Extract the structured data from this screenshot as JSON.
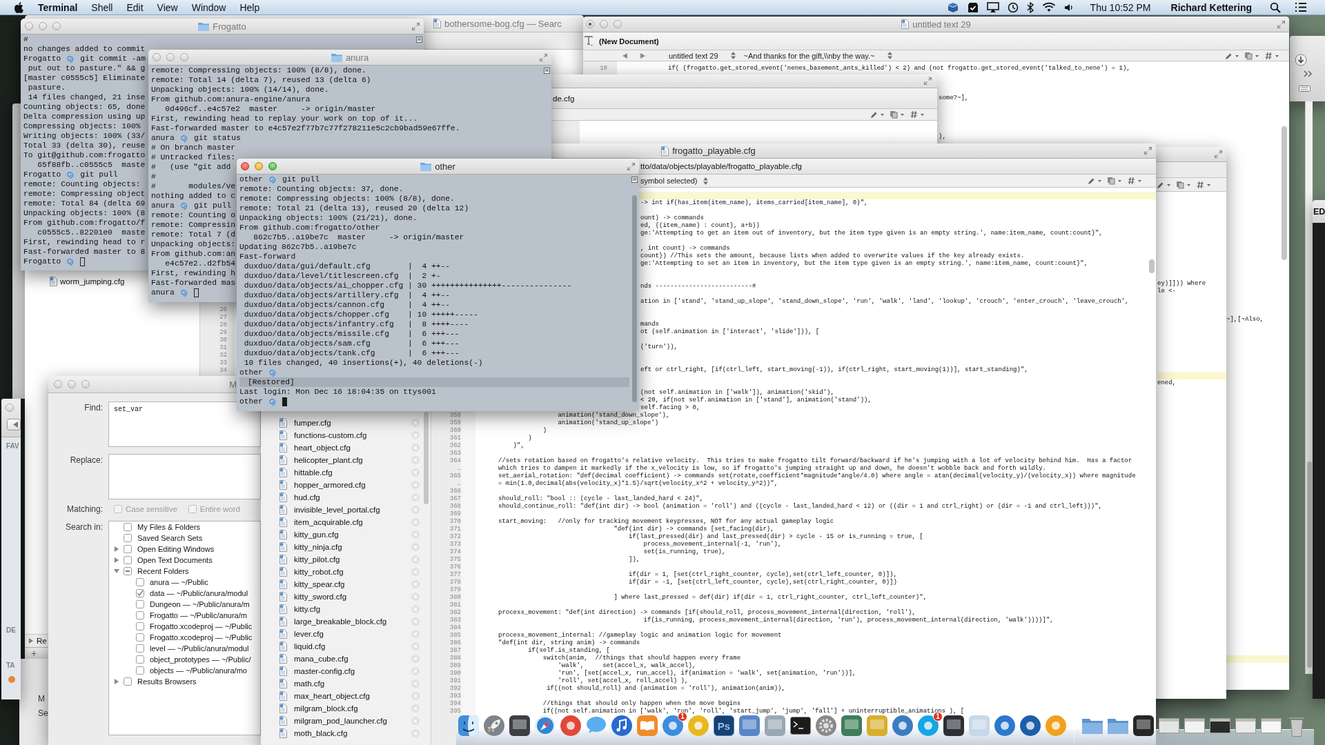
{
  "menu_bar": {
    "app": "Terminal",
    "menus": [
      "Shell",
      "Edit",
      "View",
      "Window",
      "Help"
    ],
    "clock": "Thu 10:52 PM",
    "user": "Richard Kettering"
  },
  "finder_window": {
    "headings": [
      "FAV",
      "DE",
      "TA"
    ],
    "tags": [
      {
        "color": "#e8883a"
      }
    ]
  },
  "bothersome_window": {
    "title": "bothersome-bog.cfg — Searc",
    "files": [
      "worm_jumping.cfg"
    ],
    "line_numbers": [
      "26",
      "27",
      "28",
      "29",
      "30",
      "31",
      "32",
      "33",
      "34"
    ],
    "sidebar_section": "Re",
    "add_button": "+"
  },
  "lower_window": {
    "labels": [
      "M",
      "Se"
    ]
  },
  "right_window": {
    "title": "ED"
  },
  "untitled_window": {
    "title": "untitled text 29",
    "focused": false,
    "unsaved": true,
    "toolbar_label": "(New Document)",
    "document_popup": "untitled text 29",
    "symbol_popup": "~And thanks for the gift,\\\\nby the way.~",
    "code": [
      {
        "n": "10",
        "text": "if( (frogatto.get_stored_event('nenes_basement_ants_killed') < 2) and (not frogatto.get_stored_event('talked_to_nene') = 1),"
      }
    ],
    "center_fragments": [
      "some?~],",
      "),"
    ],
    "right_fragments": [
      "~],[~Also,"
    ],
    "current_line_highlight": true
  },
  "middle_window": {
    "fragments": [
      "ey)]])) where",
      "le <-",
      "ened,"
    ],
    "current_line_highlight": true
  },
  "de_window": {
    "path": "de.cfg"
  },
  "find_dialog": {
    "title": "M",
    "focused": false,
    "find_label": "Find:",
    "find_value": "set_var",
    "replace_label": "Replace:",
    "matching_label": "Matching:",
    "matching": [
      {
        "label": "Case sensitive",
        "checked": false,
        "disabled": true
      },
      {
        "label": "Entire word",
        "checked": false,
        "disabled": true
      }
    ],
    "search_in_label": "Search in:",
    "search_in": [
      {
        "kind": "leaf",
        "label": "My Files & Folders",
        "checked": false,
        "mixed": false
      },
      {
        "kind": "leaf",
        "label": "Saved Search Sets",
        "checked": false,
        "mixed": false
      },
      {
        "kind": "group",
        "label": "Open Editing Windows",
        "checked": false,
        "mixed": false,
        "expanded": false
      },
      {
        "kind": "group",
        "label": "Open Text Documents",
        "checked": false,
        "mixed": false,
        "expanded": false
      },
      {
        "kind": "group",
        "label": "Recent Folders",
        "checked": false,
        "mixed": true,
        "expanded": true,
        "children": [
          {
            "label": "anura — ~/Public",
            "checked": false
          },
          {
            "label": "data — ~/Public/anura/modul",
            "checked": true
          },
          {
            "label": "Dungeon — ~/Public/anura/m",
            "checked": false
          },
          {
            "label": "Frogatto — ~/Public/anura/m",
            "checked": false
          },
          {
            "label": "Frogatto.xcodeproj — ~/Public",
            "checked": false
          },
          {
            "label": "Frogatto.xcodeproj — ~/Public",
            "checked": false
          },
          {
            "label": "level — ~/Public/anura/modul",
            "checked": false
          },
          {
            "label": "object_prototypes — ~/Public/",
            "checked": false
          },
          {
            "label": "objects — ~/Public/anura/mo",
            "checked": false
          }
        ]
      },
      {
        "kind": "group",
        "label": "Results Browsers",
        "checked": false,
        "mixed": false,
        "expanded": false
      }
    ]
  },
  "playable_window": {
    "title": "frogatto_playable.cfg",
    "path": "tto/data/objects/playable/frogatto_playable.cfg",
    "symbol_popup": "symbol selected)",
    "current_line_highlight": true,
    "files": [
      "fumper.cfg",
      "functions-custom.cfg",
      "heart_object.cfg",
      "helicopter_plant.cfg",
      "hittable.cfg",
      "hopper_armored.cfg",
      "hud.cfg",
      "invisible_level_portal.cfg",
      "item_acquirable.cfg",
      "kitty_gun.cfg",
      "kitty_ninja.cfg",
      "kitty_pilot.cfg",
      "kitty_robot.cfg",
      "kitty_spear.cfg",
      "kitty_sword.cfg",
      "kitty.cfg",
      "large_breakable_block.cfg",
      "lever.cfg",
      "liquid.cfg",
      "mana_cube.cfg",
      "master-config.cfg",
      "math.cfg",
      "max_heart_object.cfg",
      "milgram_block.cfg",
      "milgram_pod_launcher.cfg",
      "moth_black.cfg"
    ],
    "upper_fragments": [
      "-> int if(has_item(item_name), items_carried[item_name], 0)\",",
      "ount) -> commands",
      "ed, {(item_name) : count}, a+b))",
      "ge:'Attempting to get an item out of inventory, but the item type given is an empty string.', name:item_name, count:count}\",",
      ", int count) -> commands",
      "count}) //This sets the amount, because lists when added to overwrite values if the key already exists.",
      "ge:'Attempting to set an item in inventory, but the item type given is an empty string.', name:item_name, count:count}\",",
      "nds --------------------------#",
      "ation in ['stand', 'stand_up_slope', 'stand_down_slope', 'run', 'walk', 'land', 'lookup', 'crouch', 'enter_crouch', 'leave_crouch',",
      "mands",
      "ot (self.animation in ['interact', 'slide'])), [",
      "('turn')),",
      "eft or ctrl_right, [if(ctrl_left, start_moving(-1)), if(ctrl_right, start_moving(1))], start_standing)\",",
      "(not self.animation in ['walk']), animation('skid'),",
      "< 20, if(not self.animation in ['stand'], animation('stand')),",
      "self.facing > 0,"
    ],
    "code": [
      {
        "n": "358",
        "text": "                animation('stand_down_slope'),"
      },
      {
        "n": "359",
        "text": "                animation('stand_up_slope')"
      },
      {
        "n": "360",
        "text": "            )"
      },
      {
        "n": "361",
        "text": "        )"
      },
      {
        "n": "362",
        "text": "    )\","
      },
      {
        "n": "363"
      },
      {
        "n": "364",
        "text": "//sets rotation based on frogatto's relative velocity.  This tries to make frogatto tilt forward/backward if he's jumping with a lot of velocity behind him.  Has a factor"
      },
      {
        "n": "…",
        "text": "which tries to dampen it markedly if the x_velocity is low, so if frogatto's jumping straight up and down, he doesn't wobble back and forth wildly."
      },
      {
        "n": "365",
        "text": "set_aerial_rotation: \"def(decimal coefficient) -> commands set(rotate,coefficient*magnitude*angle/4.0) where angle = atan(decimal(velocity_y)/(velocity_x)) where magnitude"
      },
      {
        "n": "…",
        "text": "= min(1.0,decimal(abs(velocity_x)*1.5)/sqrt(velocity_x^2 + velocity_y^2))\","
      },
      {
        "n": "366"
      },
      {
        "n": "367",
        "text": "should_roll: \"bool :: (cycle - last_landed_hard < 24)\","
      },
      {
        "n": "368",
        "text": "should_continue_roll: \"def(int dir) -> bool (animation = 'roll') and ((cycle - last_landed_hard < 12) or ((dir = 1 and ctrl_right) or (dir = -1 and ctrl_left)))\","
      },
      {
        "n": "369"
      },
      {
        "n": "370",
        "text": "start_moving:   //only for tracking movement keypresses, NOT for any actual gameplay logic"
      },
      {
        "n": "371",
        "text": "                               \"def(int dir) -> commands [set_facing(dir),"
      },
      {
        "n": "372",
        "text": "                                   if(last_pressed(dir) and last_pressed(dir) > cycle - 15 or is_running = true, ["
      },
      {
        "n": "373",
        "text": "                                       process_movement_internal(-1, 'run'),"
      },
      {
        "n": "374",
        "text": "                                       set(is_running, true),"
      },
      {
        "n": "375",
        "text": "                                   ]),"
      },
      {
        "n": "376"
      },
      {
        "n": "377",
        "text": "                                   if(dir = 1, [set(ctrl_right_counter, cycle),set(ctrl_left_counter, 0)]),"
      },
      {
        "n": "378",
        "text": "                                   if(dir = -1, [set(ctrl_left_counter, cycle),set(ctrl_right_counter, 0)])"
      },
      {
        "n": "379"
      },
      {
        "n": "380",
        "text": "                               ] where last_pressed = def(dir) if(dir = 1, ctrl_right_counter, ctrl_left_counter)\","
      },
      {
        "n": "381"
      },
      {
        "n": "382",
        "text": "process_movement: \"def(int direction) -> commands [if(should_roll, process_movement_internal(direction, 'roll'),"
      },
      {
        "n": "383",
        "text": "                                       if(is_running, process_movement_internal(direction, 'run'), process_movement_internal(direction, 'walk'))))]\","
      },
      {
        "n": "384"
      },
      {
        "n": "385",
        "text": "process_movement_internal: //gameplay logic and animation logic for movement"
      },
      {
        "n": "386",
        "text": "\"def(int dir, string anim) -> commands"
      },
      {
        "n": "387",
        "text": "        if(self.is_standing, ["
      },
      {
        "n": "388",
        "text": "            switch(anim,  //things that should happen every frame"
      },
      {
        "n": "389",
        "text": "                'walk',     set(accel_x, walk_accel),"
      },
      {
        "n": "390",
        "text": "                'run', [set(accel_x, run_accel), if(animation = 'walk', set(animation, 'run'))],"
      },
      {
        "n": "391",
        "text": "                'roll', set(accel_x, roll_accel) ),"
      },
      {
        "n": "392",
        "text": "             if((not should_roll) and (animation = 'roll'), animation(anim)),"
      },
      {
        "n": "393"
      },
      {
        "n": "394",
        "text": "            //things that should only happen when the move begins"
      },
      {
        "n": "395",
        "text": "            if((not self.animation in ['walk', 'run', 'roll', 'start_jump', 'jump', 'fall'] + uninterruptible_animations ), ["
      }
    ]
  },
  "terminals": [
    {
      "title": "Frogatto",
      "focused": false,
      "lines": [
        {
          "kind": "out",
          "text": "#"
        },
        {
          "kind": "out",
          "text": "no changes added to commit"
        },
        {
          "kind": "prompt",
          "host": "Frogatto",
          "text": "git commit -am"
        },
        {
          "kind": "out",
          "text": " put out to pasture.\" && g"
        },
        {
          "kind": "out",
          "text": "[master c0555c5] Eliminate"
        },
        {
          "kind": "out",
          "text": " pasture."
        },
        {
          "kind": "out",
          "text": " 14 files changed, 21 inse"
        },
        {
          "kind": "out",
          "text": "Counting objects: 65, done"
        },
        {
          "kind": "out",
          "text": "Delta compression using up"
        },
        {
          "kind": "out",
          "text": "Compressing objects: 100%"
        },
        {
          "kind": "out",
          "text": "Writing objects: 100% (33/"
        },
        {
          "kind": "out",
          "text": "Total 33 (delta 30), reuse"
        },
        {
          "kind": "out",
          "text": "To git@github.com:frogatto"
        },
        {
          "kind": "out",
          "text": "   65f88fb..c0555c5  maste"
        },
        {
          "kind": "prompt",
          "host": "Frogatto",
          "text": "git pull"
        },
        {
          "kind": "out",
          "text": "remote: Counting objects:"
        },
        {
          "kind": "out",
          "text": "remote: Compressing object"
        },
        {
          "kind": "out",
          "text": "remote: Total 84 (delta 69"
        },
        {
          "kind": "out",
          "text": "Unpacking objects: 100% (8"
        },
        {
          "kind": "out",
          "text": "From github.com:frogatto/f"
        },
        {
          "kind": "out",
          "text": "   c0555c5..82201e0  maste"
        },
        {
          "kind": "out",
          "text": "First, rewinding head to r"
        },
        {
          "kind": "out",
          "text": "Fast-forwarded master to 8"
        },
        {
          "kind": "cursor",
          "host": "Frogatto"
        }
      ]
    },
    {
      "title": "anura",
      "focused": false,
      "lines": [
        {
          "kind": "out",
          "text": "remote: Compressing objects: 100% (8/8), done."
        },
        {
          "kind": "out",
          "text": "remote: Total 14 (delta 7), reused 13 (delta 6)"
        },
        {
          "kind": "out",
          "text": "Unpacking objects: 100% (14/14), done."
        },
        {
          "kind": "out",
          "text": "From github.com:anura-engine/anura"
        },
        {
          "kind": "out",
          "text": "   0d496cf..e4c57e2  master     -> origin/master"
        },
        {
          "kind": "out",
          "text": "First, rewinding head to replay your work on top of it..."
        },
        {
          "kind": "out",
          "text": "Fast-forwarded master to e4c57e2f77b7c77f278211e5c2cb9bad59e67ffe."
        },
        {
          "kind": "prompt",
          "host": "anura",
          "text": "git status"
        },
        {
          "kind": "out",
          "text": "# On branch master"
        },
        {
          "kind": "out",
          "text": "# Untracked files:"
        },
        {
          "kind": "out",
          "text": "#   (use \"git add"
        },
        {
          "kind": "out",
          "text": "#"
        },
        {
          "kind": "out",
          "text": "#       modules/ve"
        },
        {
          "kind": "out",
          "text": "nothing added to c"
        },
        {
          "kind": "prompt",
          "host": "anura",
          "text": "git pull"
        },
        {
          "kind": "out",
          "text": "remote: Counting o"
        },
        {
          "kind": "out",
          "text": "remote: Compressin"
        },
        {
          "kind": "out",
          "text": "remote: Total 7 (d"
        },
        {
          "kind": "out",
          "text": "Unpacking objects:"
        },
        {
          "kind": "out",
          "text": "From github.com:an"
        },
        {
          "kind": "out",
          "text": "   e4c57e2..d2fb54"
        },
        {
          "kind": "out",
          "text": "First, rewinding h"
        },
        {
          "kind": "out",
          "text": "Fast-forwarded mas"
        },
        {
          "kind": "cursor",
          "host": "anura"
        }
      ]
    },
    {
      "title": "other",
      "focused": true,
      "lines": [
        {
          "kind": "prompt",
          "host": "other",
          "text": "git pull"
        },
        {
          "kind": "out",
          "text": "remote: Counting objects: 37, done."
        },
        {
          "kind": "out",
          "text": "remote: Compressing objects: 100% (8/8), done."
        },
        {
          "kind": "out",
          "text": "remote: Total 21 (delta 13), reused 20 (delta 12)"
        },
        {
          "kind": "out",
          "text": "Unpacking objects: 100% (21/21), done."
        },
        {
          "kind": "out",
          "text": "From github.com:frogatto/other"
        },
        {
          "kind": "out",
          "text": "   862c7b5..a19be7c  master     -> origin/master"
        },
        {
          "kind": "out",
          "text": "Updating 862c7b5..a19be7c"
        },
        {
          "kind": "out",
          "text": "Fast-forward"
        },
        {
          "kind": "out",
          "text": " duxduo/data/gui/default.cfg        |  4 ++--"
        },
        {
          "kind": "out",
          "text": " duxduo/data/level/titlescreen.cfg  |  2 +-"
        },
        {
          "kind": "out",
          "text": " duxduo/data/objects/ai_chopper.cfg | 30 +++++++++++++++---------------"
        },
        {
          "kind": "out",
          "text": " duxduo/data/objects/artillery.cfg  |  4 ++--"
        },
        {
          "kind": "out",
          "text": " duxduo/data/objects/cannon.cfg     |  4 ++--"
        },
        {
          "kind": "out",
          "text": " duxduo/data/objects/chopper.cfg    | 10 +++++-----"
        },
        {
          "kind": "out",
          "text": " duxduo/data/objects/infantry.cfg   |  8 ++++----"
        },
        {
          "kind": "out",
          "text": " duxduo/data/objects/missile.cfg    |  6 +++---"
        },
        {
          "kind": "out",
          "text": " duxduo/data/objects/sam.cfg        |  6 +++---"
        },
        {
          "kind": "out",
          "text": " duxduo/data/objects/tank.cfg       |  6 +++---"
        },
        {
          "kind": "out",
          "text": " 10 files changed, 40 insertions(+), 40 deletions(-)"
        },
        {
          "kind": "prompt",
          "host": "other"
        },
        {
          "kind": "restored",
          "text": "[Restored]"
        },
        {
          "kind": "out",
          "text": "Last login: Mon Dec 16 18:04:35 on ttys001"
        },
        {
          "kind": "cursor",
          "host": "other"
        }
      ]
    }
  ],
  "dock": [
    {
      "kind": "face",
      "color": "#3f8fdc"
    },
    {
      "kind": "rocket",
      "color": "#7d848c"
    },
    {
      "kind": "tile",
      "color": "#3d3f44"
    },
    {
      "kind": "compass",
      "color": "#2f86d8"
    },
    {
      "kind": "disc",
      "color": "#e0483a"
    },
    {
      "kind": "bubble",
      "color": "#58aef0"
    },
    {
      "kind": "note",
      "color": "#2a6ad0"
    },
    {
      "kind": "book",
      "color": "#f08c28"
    },
    {
      "kind": "disc",
      "color": "#3a8de0",
      "badge": "1"
    },
    {
      "kind": "disc",
      "color": "#e8b820"
    },
    {
      "kind": "letters",
      "color": "#1b3f70",
      "label": "Ps"
    },
    {
      "kind": "tile",
      "color": "#5a86c8"
    },
    {
      "kind": "tile",
      "color": "#9aa8b4"
    },
    {
      "kind": "terminal",
      "color": "#1c1c1c"
    },
    {
      "kind": "gear",
      "color": "#8a8a8a"
    },
    {
      "kind": "tile",
      "color": "#3e7e5a"
    },
    {
      "kind": "tile",
      "color": "#d8ae2c"
    },
    {
      "kind": "disc",
      "color": "#3a7cc0"
    },
    {
      "kind": "disc",
      "color": "#14a6e6",
      "badge": "1"
    },
    {
      "kind": "tile",
      "color": "#2c3036"
    },
    {
      "kind": "tile",
      "color": "#c8d8e8"
    },
    {
      "kind": "disc",
      "color": "#2c78cc"
    },
    {
      "kind": "disc",
      "color": "#1d5ea8"
    },
    {
      "kind": "disc",
      "color": "#f0a21e"
    },
    {
      "kind": "separator"
    },
    {
      "kind": "folder",
      "color": "#86b4e4"
    },
    {
      "kind": "folder",
      "color": "#86b4e4"
    },
    {
      "kind": "tile",
      "color": "#262626"
    },
    {
      "kind": "window",
      "color": "#e4e4e4"
    },
    {
      "kind": "window",
      "color": "#f2f2f2"
    },
    {
      "kind": "window",
      "color": "#2a2a2a"
    },
    {
      "kind": "window",
      "color": "#eaeaea"
    },
    {
      "kind": "window",
      "color": "#f6f6f6"
    },
    {
      "kind": "trash",
      "color": "#c9c9c9"
    }
  ]
}
